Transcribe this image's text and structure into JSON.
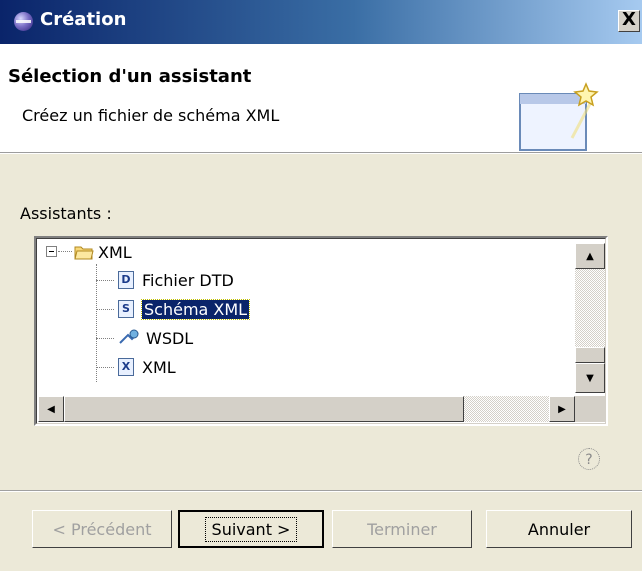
{
  "window": {
    "title": "Création",
    "close_label": "X"
  },
  "header": {
    "title": "Sélection d'un assistant",
    "description": "Créez un fichier de schéma XML"
  },
  "assistants": {
    "label": "Assistants :",
    "tree": {
      "folder": "XML",
      "items": [
        "Fichier DTD",
        "Schéma XML",
        "WSDL",
        "XML"
      ],
      "selected": "Schéma XML"
    }
  },
  "help": {
    "glyph": "?"
  },
  "buttons": {
    "back": "< Précédent",
    "next": "Suivant >",
    "finish": "Terminer",
    "cancel": "Annuler"
  },
  "colors": {
    "selection": "#0a246a",
    "titlebar": "#0a246a",
    "dialog_bg": "#ece9d8"
  },
  "icons": [
    "eclipse-icon",
    "wizard-icon",
    "folder-icon",
    "dtd-file-icon",
    "schema-file-icon",
    "wsdl-icon",
    "xml-file-icon",
    "help-icon"
  ]
}
